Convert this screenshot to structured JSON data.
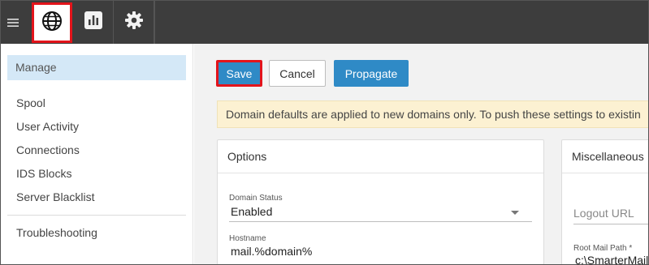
{
  "topbar": {
    "menu_icon": "hamburger-icon",
    "buttons": [
      {
        "icon": "globe-icon",
        "active": true
      },
      {
        "icon": "chart-icon",
        "active": false
      },
      {
        "icon": "gear-icon",
        "active": false
      }
    ]
  },
  "sidebar": {
    "manage": "Manage",
    "items": [
      "Spool",
      "User Activity",
      "Connections",
      "IDS Blocks",
      "Server Blacklist"
    ],
    "troubleshooting": "Troubleshooting"
  },
  "toolbar": {
    "save_label": "Save",
    "cancel_label": "Cancel",
    "propagate_label": "Propagate"
  },
  "notice": "Domain defaults are applied to new domains only. To push these settings to existin",
  "options": {
    "title": "Options",
    "domain_status_label": "Domain Status",
    "domain_status_value": "Enabled",
    "hostname_label": "Hostname",
    "hostname_value": "mail.%domain%"
  },
  "misc": {
    "title": "Miscellaneous",
    "logout_url_placeholder": "Logout URL",
    "root_mail_path_label": "Root Mail Path *",
    "root_mail_path_value": "c:\\SmarterMail"
  },
  "colors": {
    "topbar_bg": "#3d3d3d",
    "accent_blue": "#2f8ac6",
    "highlight_red": "#e3141b",
    "sidebar_selected": "#d4e8f7",
    "notice_bg": "#fcf1d2"
  }
}
